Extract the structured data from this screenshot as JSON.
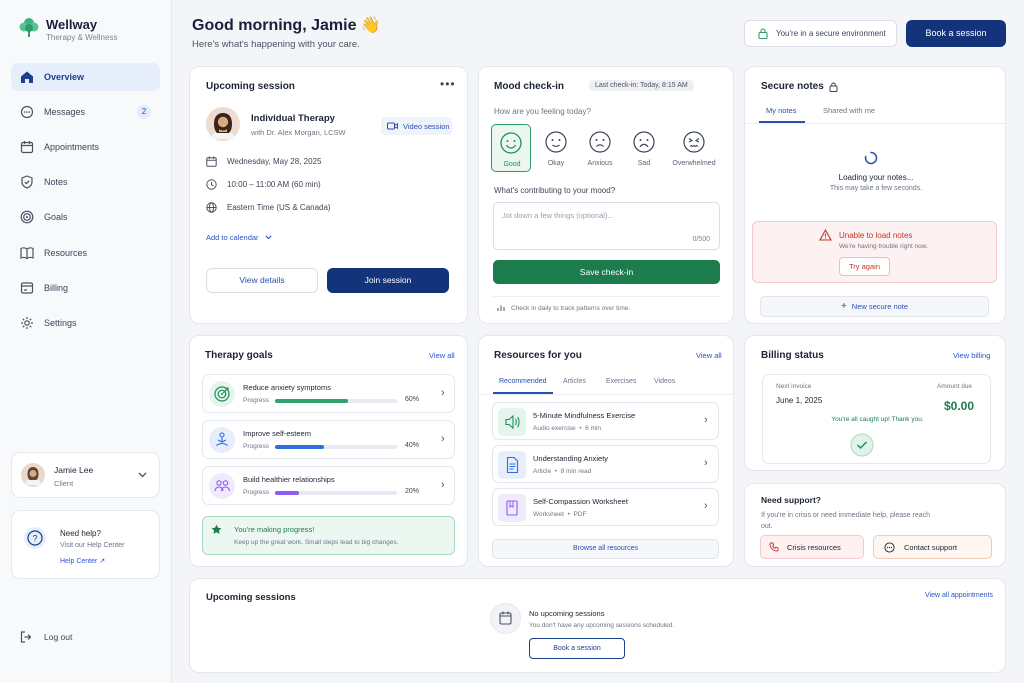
{
  "brand": {
    "name": "Wellway",
    "subtitle": "Therapy & Wellness",
    "accent": "#1d8f5a",
    "navy": "#13337a"
  },
  "sidebar": {
    "items": [
      {
        "label": "Overview",
        "icon": "home-icon",
        "active": true
      },
      {
        "label": "Messages",
        "icon": "chat-icon",
        "badge": "2"
      },
      {
        "label": "Appointments",
        "icon": "calendar-icon"
      },
      {
        "label": "Notes",
        "icon": "shield-icon"
      },
      {
        "label": "Goals",
        "icon": "target-icon"
      },
      {
        "label": "Resources",
        "icon": "book-icon"
      },
      {
        "label": "Billing",
        "icon": "billing-icon"
      },
      {
        "label": "Settings",
        "icon": "gear-icon"
      }
    ],
    "user": {
      "name": "Jamie Lee",
      "role": "Client"
    },
    "help": {
      "title": "Need help?",
      "text": "Visit our Help Center",
      "link": "Help Center ↗"
    },
    "logout": "Log out"
  },
  "header": {
    "greeting": "Good morning, Jamie 👋",
    "subtitle": "Here's what's happening with your care.",
    "secure_label": "You're in a secure environment",
    "book_button": "Book a session"
  },
  "upcoming": {
    "title": "Upcoming session",
    "type": "Individual Therapy",
    "therapist": "with Dr. Alex Morgan, LCSW",
    "mode": "Video session",
    "date": "Wednesday, May 28, 2025",
    "time": "10:00 – 11:00 AM (60 min)",
    "timezone": "Eastern Time (US & Canada)",
    "add_calendar": "Add to calendar",
    "details_button": "View details",
    "join_button": "Join session"
  },
  "mood": {
    "title": "Mood check-in",
    "last": "Last check-in: Today, 8:15 AM",
    "question": "How are you feeling today?",
    "options": [
      "Good",
      "Okay",
      "Anxious",
      "Sad",
      "Overwhelmed"
    ],
    "selected": "Good",
    "contrib_label": "What's contributing to your mood?",
    "placeholder": "Jot down a few things (optional)...",
    "counter": "0/500",
    "save_button": "Save check-in",
    "footer": "Check in daily to track patterns over time."
  },
  "notes": {
    "title": "Secure notes",
    "tabs": [
      "My notes",
      "Shared with me"
    ],
    "loading_title": "Loading your notes...",
    "loading_sub": "This may take a few seconds.",
    "error_title": "Unable to load notes",
    "error_sub": "We're having trouble right now.",
    "retry": "Try again",
    "new_note": "New secure note"
  },
  "goals": {
    "title": "Therapy goals",
    "view_all": "View all",
    "progress_label": "Progress",
    "items": [
      {
        "name": "Reduce anxiety symptoms",
        "pct": "60%",
        "value": 0.6,
        "color": "#2fa36b"
      },
      {
        "name": "Improve self-esteem",
        "pct": "40%",
        "value": 0.4,
        "color": "#2c6fe0"
      },
      {
        "name": "Build healthier relationships",
        "pct": "20%",
        "value": 0.2,
        "color": "#8b5cf6"
      }
    ],
    "banner_title": "You're making progress!",
    "banner_text": "Keep up the great work. Small steps lead to big changes."
  },
  "resources": {
    "title": "Resources for you",
    "view_all": "View all",
    "tabs": [
      "Recommended",
      "Articles",
      "Exercises",
      "Videos"
    ],
    "items": [
      {
        "name": "5-Minute Mindfulness Exercise",
        "kind": "Audio exercise",
        "meta": "6 min"
      },
      {
        "name": "Understanding Anxiety",
        "kind": "Article",
        "meta": "8 min read"
      },
      {
        "name": "Self-Compassion Worksheet",
        "kind": "Worksheet",
        "meta": "PDF"
      }
    ],
    "browse": "Browse all resources"
  },
  "billing": {
    "title": "Billing status",
    "view": "View billing",
    "next_label": "Next invoice",
    "next_date": "June 1, 2025",
    "amount_label": "Amount due",
    "amount": "$0.00",
    "status": "You're all caught up! Thank you."
  },
  "support": {
    "title": "Need support?",
    "text": "If you're in crisis or need immediate help, please reach out.",
    "crisis": "Crisis resources",
    "contact": "Contact support"
  },
  "sessions": {
    "title": "Upcoming sessions",
    "view_all": "View all appointments",
    "empty_title": "No upcoming sessions",
    "empty_text": "You don't have any upcoming sessions scheduled.",
    "book": "Book a session"
  }
}
